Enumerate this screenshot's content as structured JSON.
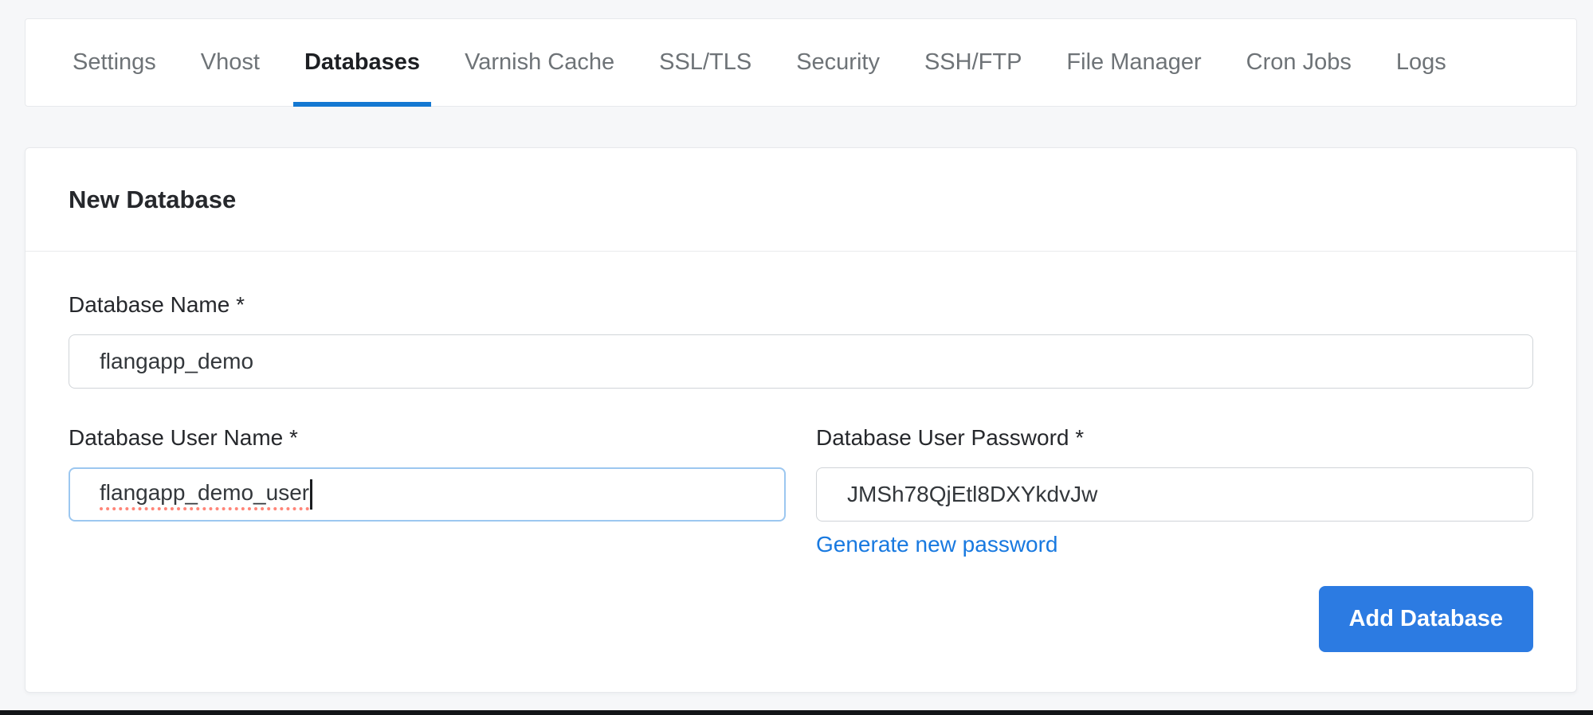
{
  "colors": {
    "page_bg": "#f6f7f9",
    "card_border": "#e7e9ec",
    "tab_inactive": "#6e7377",
    "tab_active": "#1d1f23",
    "accent_underline": "#1478d2",
    "label_text": "#26282c",
    "input_border": "#d0d4d8",
    "input_text": "#33373b",
    "focus_border": "#9cc7f0",
    "spellcheck_red": "#ff8578",
    "link_blue": "#1879e0",
    "button_blue": "#2c7be2",
    "button_text": "#ffffff",
    "bottom_edge": "#131518"
  },
  "tabs": {
    "items": [
      {
        "label": "Settings",
        "active": false
      },
      {
        "label": "Vhost",
        "active": false
      },
      {
        "label": "Databases",
        "active": true
      },
      {
        "label": "Varnish Cache",
        "active": false
      },
      {
        "label": "SSL/TLS",
        "active": false
      },
      {
        "label": "Security",
        "active": false
      },
      {
        "label": "SSH/FTP",
        "active": false
      },
      {
        "label": "File Manager",
        "active": false
      },
      {
        "label": "Cron Jobs",
        "active": false
      },
      {
        "label": "Logs",
        "active": false
      }
    ]
  },
  "card": {
    "title": "New Database",
    "database_name": {
      "label": "Database Name *",
      "value": "flangapp_demo"
    },
    "database_user_name": {
      "label": "Database User Name *",
      "value": "flangapp_demo_user",
      "focused": true
    },
    "database_user_password": {
      "label": "Database User Password *",
      "value": "JMSh78QjEtl8DXYkdvJw"
    },
    "generate_link_label": "Generate new password",
    "add_button_label": "Add Database"
  }
}
